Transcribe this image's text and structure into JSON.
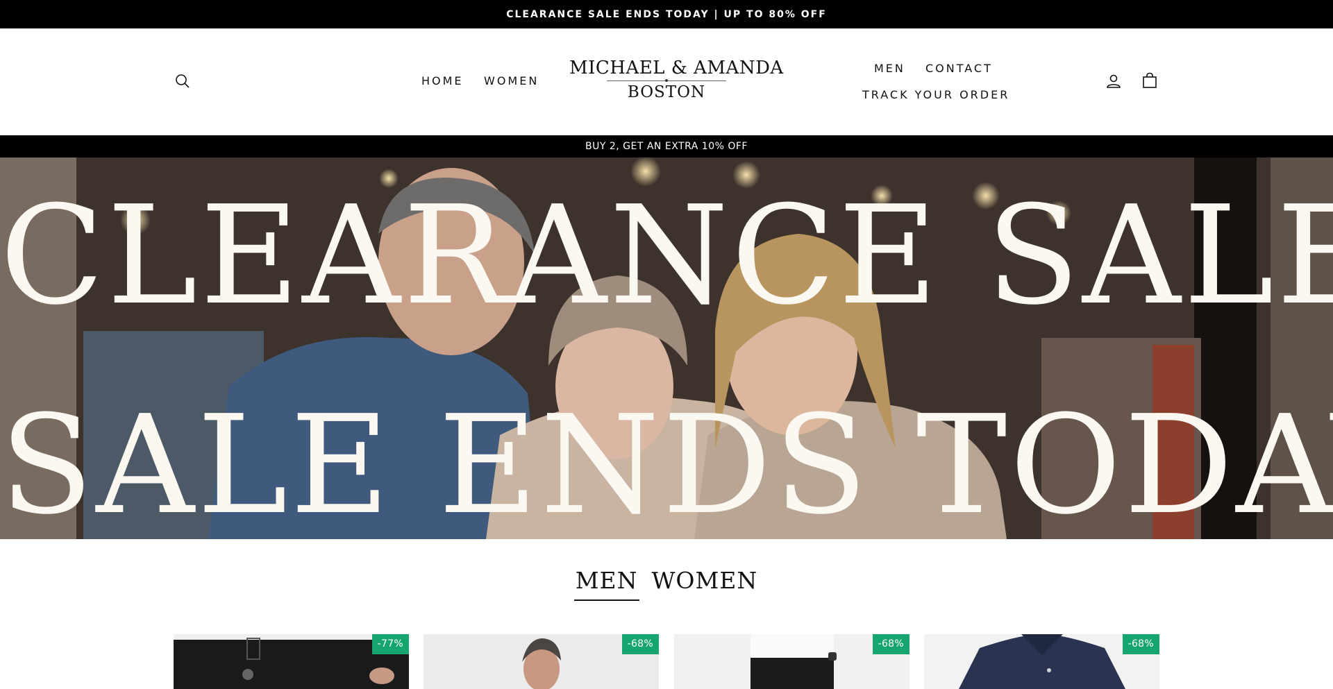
{
  "announcement": {
    "text": "CLEARANCE SALE ENDS TODAY | UP TO 80% OFF"
  },
  "header": {
    "nav_left": [
      "HOME",
      "WOMEN"
    ],
    "nav_right_top": [
      "MEN",
      "CONTACT"
    ],
    "nav_right_bottom": "TRACK YOUR ORDER",
    "logo": {
      "top": "MICHAEL & AMANDA",
      "bottom": "BOSTON"
    },
    "icons": {
      "search": "search-icon",
      "account": "account-icon",
      "cart": "cart-icon"
    }
  },
  "promo": {
    "text": "BUY 2, GET AN EXTRA 10% OFF"
  },
  "hero": {
    "line1": "CLEARANCE SALE",
    "line2": "SALE ENDS TODAY"
  },
  "tabs": [
    {
      "label": "MEN",
      "active": true
    },
    {
      "label": "WOMEN",
      "active": false
    }
  ],
  "products": [
    {
      "badge": "-77%"
    },
    {
      "badge": "-68%"
    },
    {
      "badge": "-68%"
    },
    {
      "badge": "-68%"
    }
  ],
  "colors": {
    "badge": "#16a56e",
    "bars": "#000000",
    "hero_text": "#fbf8f1"
  }
}
